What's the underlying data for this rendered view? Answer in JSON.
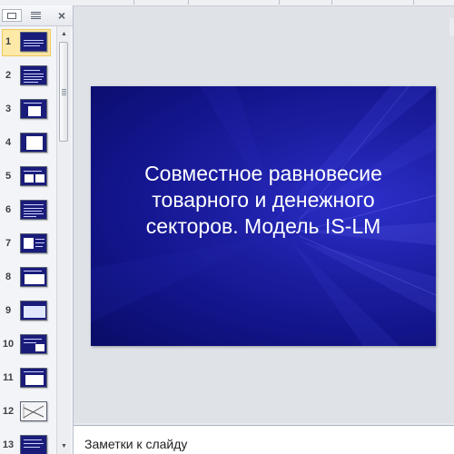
{
  "pane": {
    "tabs": [
      {
        "name": "slides-tab-icon"
      },
      {
        "name": "outline-tab-icon"
      }
    ],
    "close_label": "×"
  },
  "thumbnails": [
    {
      "number": "1"
    },
    {
      "number": "2"
    },
    {
      "number": "3"
    },
    {
      "number": "4"
    },
    {
      "number": "5"
    },
    {
      "number": "6"
    },
    {
      "number": "7"
    },
    {
      "number": "8"
    },
    {
      "number": "9"
    },
    {
      "number": "10"
    },
    {
      "number": "11"
    },
    {
      "number": "12"
    },
    {
      "number": "13"
    }
  ],
  "selected_slide": "1",
  "slide": {
    "title_lines": [
      "Совместное равновесие",
      "товарного и денежного",
      "секторов. Модель IS-LM"
    ],
    "background_color": "#1a1c9a"
  },
  "notes": {
    "placeholder": "Заметки к слайду"
  },
  "colors": {
    "selection": "#fde9a8",
    "slide_dark": "#0a0c66"
  }
}
